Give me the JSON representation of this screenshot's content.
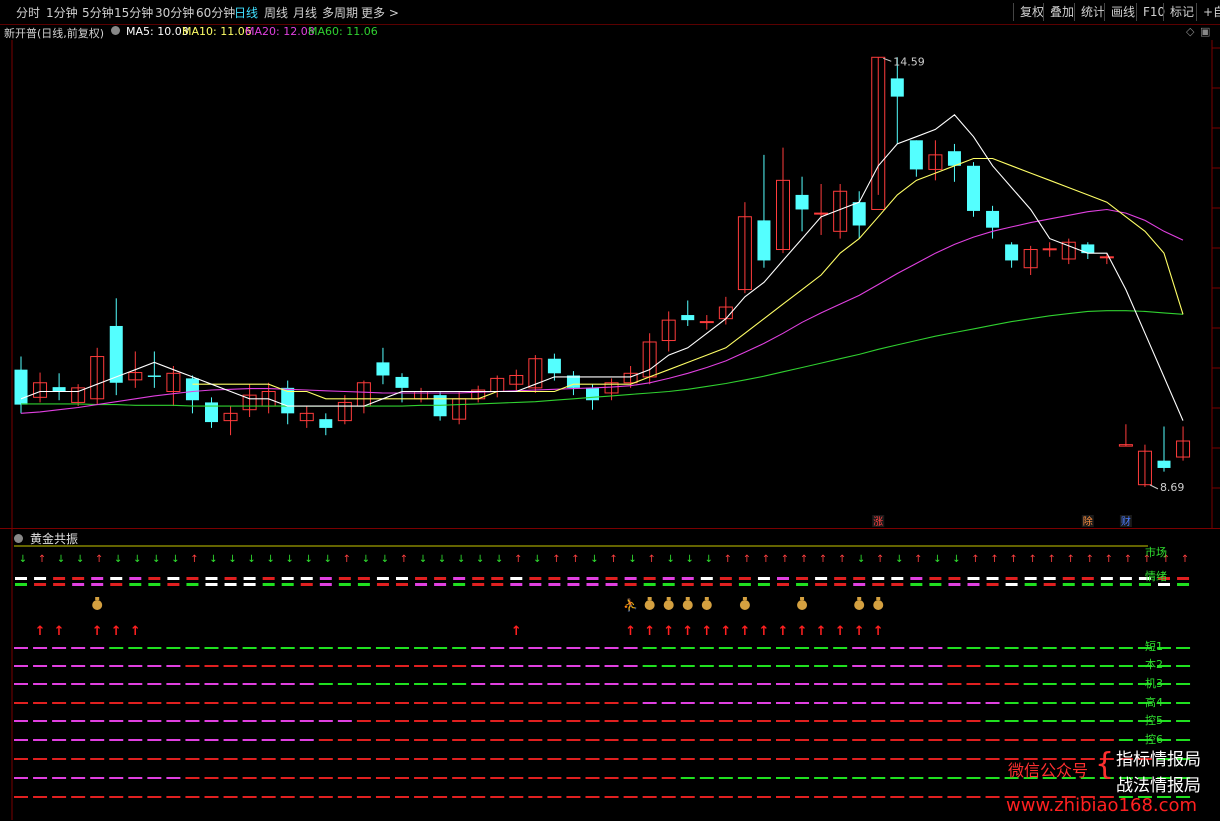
{
  "toolbar": {
    "periods": [
      "分时",
      "1分钟",
      "5分钟",
      "15分钟",
      "30分钟",
      "60分钟",
      "日线",
      "周线",
      "月线",
      "多周期",
      "更多 >"
    ],
    "active_period": "日线",
    "buttons": [
      "复权",
      "叠加",
      "统计",
      "画线",
      "F10",
      "标记",
      "+自选"
    ]
  },
  "info": {
    "stock_name": "新开普(日线,前复权)",
    "ma5": "MA5: 10.03",
    "ma10": "MA10: 11.06",
    "ma20": "MA20: 12.08",
    "ma60": "MA60: 11.06",
    "colors": {
      "ma5": "#ffffff",
      "ma10": "#ffff66",
      "ma20": "#e040e0",
      "ma60": "#30d030"
    }
  },
  "chart_data": {
    "type": "candlestick",
    "high_label": "14.59",
    "low_label": "8.69",
    "candles": [
      [
        10.3,
        9.82,
        10.48,
        9.7
      ],
      [
        9.92,
        10.12,
        10.26,
        9.85
      ],
      [
        10.06,
        10.0,
        10.25,
        9.88
      ],
      [
        9.85,
        10.05,
        10.1,
        9.8
      ],
      [
        9.9,
        10.48,
        10.6,
        9.82
      ],
      [
        10.9,
        10.12,
        11.28,
        9.95
      ],
      [
        10.16,
        10.26,
        10.55,
        10.05
      ],
      [
        10.22,
        10.2,
        10.55,
        10.05
      ],
      [
        10.0,
        10.25,
        10.35,
        9.8
      ],
      [
        10.18,
        9.88,
        10.22,
        9.7
      ],
      [
        9.85,
        9.58,
        9.92,
        9.5
      ],
      [
        9.6,
        9.7,
        9.8,
        9.4
      ],
      [
        9.75,
        9.95,
        10.1,
        9.65
      ],
      [
        9.8,
        10.0,
        10.12,
        9.7
      ],
      [
        10.05,
        9.7,
        10.15,
        9.55
      ],
      [
        9.6,
        9.7,
        9.8,
        9.5
      ],
      [
        9.62,
        9.5,
        9.7,
        9.4
      ],
      [
        9.6,
        9.85,
        9.95,
        9.55
      ],
      [
        9.8,
        10.12,
        10.15,
        9.7
      ],
      [
        10.4,
        10.22,
        10.6,
        10.1
      ],
      [
        10.2,
        10.05,
        10.25,
        9.85
      ],
      [
        9.9,
        10.0,
        10.05,
        9.85
      ],
      [
        9.95,
        9.66,
        10.0,
        9.6
      ],
      [
        9.62,
        9.9,
        10.0,
        9.55
      ],
      [
        9.9,
        10.02,
        10.08,
        9.85
      ],
      [
        10.0,
        10.18,
        10.22,
        9.92
      ],
      [
        10.1,
        10.22,
        10.3,
        10.0
      ],
      [
        10.05,
        10.45,
        10.5,
        9.98
      ],
      [
        10.45,
        10.25,
        10.52,
        10.15
      ],
      [
        10.22,
        10.05,
        10.28,
        9.95
      ],
      [
        10.05,
        9.88,
        10.1,
        9.75
      ],
      [
        9.98,
        10.12,
        10.18,
        9.88
      ],
      [
        10.12,
        10.25,
        10.35,
        10.05
      ],
      [
        10.2,
        10.68,
        10.8,
        10.1
      ],
      [
        10.7,
        10.98,
        11.1,
        10.55
      ],
      [
        11.05,
        10.98,
        11.25,
        10.9
      ],
      [
        10.95,
        10.96,
        11.05,
        10.85
      ],
      [
        11.0,
        11.16,
        11.3,
        10.92
      ],
      [
        11.4,
        12.4,
        12.6,
        11.35
      ],
      [
        12.35,
        11.8,
        13.25,
        11.7
      ],
      [
        11.95,
        12.9,
        13.35,
        11.9
      ],
      [
        12.7,
        12.5,
        12.95,
        12.2
      ],
      [
        12.45,
        12.45,
        12.85,
        12.15
      ],
      [
        12.2,
        12.75,
        12.85,
        12.1
      ],
      [
        12.6,
        12.28,
        12.75,
        12.1
      ],
      [
        12.5,
        14.59,
        14.59,
        12.7
      ],
      [
        14.3,
        14.05,
        14.59,
        13.4
      ],
      [
        13.45,
        13.05,
        13.45,
        12.95
      ],
      [
        13.05,
        13.25,
        13.45,
        12.9
      ],
      [
        13.3,
        13.1,
        13.4,
        12.88
      ],
      [
        13.1,
        12.48,
        13.15,
        12.4
      ],
      [
        12.48,
        12.25,
        12.55,
        12.1
      ],
      [
        12.02,
        11.8,
        12.05,
        11.7
      ],
      [
        11.7,
        11.95,
        12.0,
        11.6
      ],
      [
        11.95,
        11.96,
        12.05,
        11.85
      ],
      [
        11.82,
        12.05,
        12.1,
        11.75
      ],
      [
        12.02,
        11.9,
        12.05,
        11.82
      ],
      [
        11.85,
        11.85,
        11.9,
        11.75
      ],
      [
        9.25,
        9.27,
        9.55,
        9.25
      ],
      [
        8.72,
        9.18,
        9.27,
        8.69
      ],
      [
        9.05,
        8.95,
        9.52,
        8.9
      ],
      [
        9.1,
        9.32,
        9.52,
        9.05
      ]
    ],
    "ma5": [
      9.9,
      10.0,
      10.0,
      10.0,
      10.1,
      10.2,
      10.3,
      10.4,
      10.3,
      10.2,
      10.1,
      10.0,
      9.9,
      9.9,
      9.8,
      9.8,
      9.8,
      9.8,
      9.8,
      9.9,
      10.0,
      10.0,
      10.0,
      10.0,
      10.0,
      10.0,
      10.0,
      10.1,
      10.2,
      10.2,
      10.2,
      10.2,
      10.2,
      10.3,
      10.5,
      10.6,
      10.8,
      11.0,
      11.3,
      11.5,
      11.8,
      12.1,
      12.4,
      12.5,
      12.6,
      13.1,
      13.4,
      13.5,
      13.6,
      13.8,
      13.5,
      13.1,
      12.8,
      12.5,
      12.1,
      12.0,
      11.9,
      11.9,
      11.4,
      10.8,
      10.2,
      9.6
    ],
    "ma10": [
      null,
      null,
      null,
      null,
      null,
      null,
      null,
      null,
      null,
      10.1,
      10.1,
      10.1,
      10.1,
      10.1,
      10.0,
      10.0,
      9.9,
      9.9,
      9.9,
      9.9,
      9.9,
      9.9,
      9.9,
      9.9,
      9.9,
      10.0,
      10.0,
      10.0,
      10.0,
      10.1,
      10.1,
      10.1,
      10.1,
      10.2,
      10.3,
      10.4,
      10.5,
      10.6,
      10.8,
      11.0,
      11.2,
      11.4,
      11.6,
      11.9,
      12.1,
      12.4,
      12.7,
      12.9,
      13.0,
      13.1,
      13.2,
      13.2,
      13.1,
      13.0,
      12.9,
      12.8,
      12.7,
      12.6,
      12.4,
      12.2,
      11.9,
      11.06
    ],
    "ma20": [
      9.7,
      9.72,
      9.75,
      9.78,
      9.82,
      9.86,
      9.9,
      9.94,
      9.97,
      10.0,
      10.02,
      10.03,
      10.04,
      10.04,
      10.03,
      10.02,
      10.01,
      10.0,
      9.99,
      9.98,
      9.98,
      9.98,
      9.98,
      9.98,
      9.99,
      10.0,
      10.01,
      10.02,
      10.03,
      10.04,
      10.05,
      10.06,
      10.08,
      10.12,
      10.18,
      10.25,
      10.33,
      10.42,
      10.54,
      10.66,
      10.8,
      10.95,
      11.08,
      11.2,
      11.32,
      11.47,
      11.62,
      11.76,
      11.9,
      12.02,
      12.12,
      12.2,
      12.26,
      12.32,
      12.37,
      12.42,
      12.47,
      12.5,
      12.45,
      12.35,
      12.2,
      12.08
    ],
    "ma60": [
      9.83,
      9.83,
      9.83,
      9.83,
      9.82,
      9.82,
      9.81,
      9.81,
      9.81,
      9.8,
      9.8,
      9.8,
      9.8,
      9.8,
      9.8,
      9.8,
      9.8,
      9.8,
      9.8,
      9.8,
      9.8,
      9.81,
      9.81,
      9.82,
      9.83,
      9.84,
      9.85,
      9.86,
      9.88,
      9.9,
      9.92,
      9.94,
      9.96,
      9.98,
      10.0,
      10.03,
      10.07,
      10.11,
      10.16,
      10.21,
      10.27,
      10.33,
      10.39,
      10.45,
      10.51,
      10.58,
      10.64,
      10.7,
      10.76,
      10.81,
      10.86,
      10.91,
      10.96,
      11.0,
      11.04,
      11.07,
      11.1,
      11.11,
      11.11,
      11.1,
      11.08,
      11.06
    ],
    "ylim": [
      8.4,
      14.8
    ]
  },
  "badges": [
    {
      "index": 45,
      "text": "涨",
      "color": "#ff4040"
    },
    {
      "index": 56,
      "text": "除",
      "color": "#ff9040"
    },
    {
      "index": 58,
      "text": "财",
      "color": "#4a7cff"
    }
  ],
  "indicator": {
    "title": "黄金共振",
    "row_labels": [
      "市场",
      "情绪",
      "短1",
      "本2",
      "机3",
      "高4",
      "控5",
      "控6"
    ],
    "market_arrows": "DUDDUDDDDUDDDDDDDUDDUDDDDDUDUUDUDUDDDUUUUUUUDUDUDDUUUUUUUUUUUU",
    "dash_rows": [
      "WWRRMWMRWRWRWRWWMRRWWRRMRRWRRMMRMRMMWRRWMRWRRWWMRRWWRWWRRWWWRR",
      "GRRMMRGGRGWWWGGRMGGRRMMGRRMMMMMMRGGRRRGGRGRRMRRGGMMRWGRGGGGGWG",
      "MMMMMGGGGGGGGGGGGGGGGGGGMMMMMMMMMGGGGGGGGGGGMMMMMGGGGGGGGGGGGG",
      "MMMMMMMMMRRRRRRRRRRRRRRRMMMMMMMMMGGGGGGGGGGGMMMMMRRGGGGGGGGGGG",
      "MMMMMMMMMMMMMMMMGGGGGGGGMMMMMMMMMMMMMMMMMMMMMMMMMRRRRGGGGGGGGG",
      "RRRRRRRRRRRRRRRRRRRRRRRRRRRRRRRRRMMMMMMMMMMMMMMMMMMMGGGGGGGGGG",
      "MMMMMMMMMMMMMMMMMMRRRRRRRRRRRRRRRRRRRRRRRRRRRRRRRRRGGGGGGGGGGG",
      "MMMMMMMMMMMMMMMMRRRRRRRRRRRRRRRRRRRRRRRRRRRRRRRRRRRRRRRRRRGGGG",
      "RRRRRRRRRRRRRRRRRRRRRRRRRRRRRRRRRRRRRRRRRRRRRRRRRRRRRRRRRRRRGG",
      "MMMMMMMMMRRRRRRRRRRRRRRRRRRRRRRRRRRGGGGGGGGGGGGGGGGGGGGGGGGGGG",
      "RRRRRRRRRRRRRRRRRRRRRRRRRRRRRRRRRRRRRRRRRRRRRRRRRRRRRRRRRRGGGG"
    ],
    "money_bags": [
      4,
      33,
      34,
      35,
      36,
      38,
      41,
      44,
      45
    ],
    "person_mark": 32,
    "red_arrows": [
      1,
      2,
      4,
      5,
      6,
      26,
      32,
      33,
      34,
      35,
      36,
      37,
      38,
      39,
      40,
      41,
      42,
      43,
      44,
      45
    ]
  },
  "watermark": {
    "line1_left": "微信公众号",
    "line1_right": "指标情报局",
    "line2_right": "战法情报局",
    "url": "www.zhibiao168.com"
  }
}
